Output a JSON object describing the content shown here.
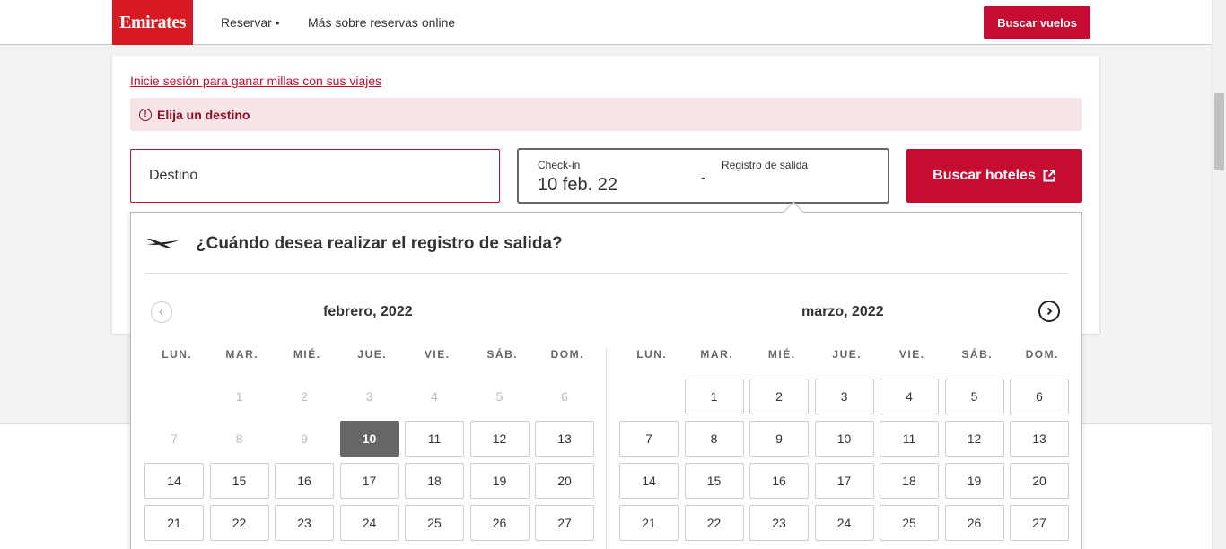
{
  "header": {
    "logo": "Emirates",
    "nav": [
      "Reservar •",
      "Más sobre reservas online"
    ],
    "cta": "Buscar vuelos"
  },
  "booking": {
    "signin_link": "Inicie sesión para ganar millas con sus viajes",
    "alert": "Elija un destino",
    "destination_placeholder": "Destino",
    "checkin_label": "Check-in",
    "checkin_value": "10 feb. 22",
    "dash": "-",
    "checkout_label": "Registro de salida",
    "search_button": "Buscar hoteles"
  },
  "calendar": {
    "question": "¿Cuándo desea realizar el registro de salida?",
    "weekdays": [
      "LUN.",
      "MAR.",
      "MIÉ.",
      "JUE.",
      "VIE.",
      "SÁB.",
      "DOM."
    ],
    "months": [
      {
        "title": "febrero, 2022",
        "days": [
          {
            "d": "",
            "state": "empty"
          },
          {
            "d": "1",
            "state": "disabled"
          },
          {
            "d": "2",
            "state": "disabled"
          },
          {
            "d": "3",
            "state": "disabled"
          },
          {
            "d": "4",
            "state": "disabled"
          },
          {
            "d": "5",
            "state": "disabled"
          },
          {
            "d": "6",
            "state": "disabled"
          },
          {
            "d": "7",
            "state": "disabled"
          },
          {
            "d": "8",
            "state": "disabled"
          },
          {
            "d": "9",
            "state": "disabled"
          },
          {
            "d": "10",
            "state": "selected"
          },
          {
            "d": "11",
            "state": "available"
          },
          {
            "d": "12",
            "state": "available"
          },
          {
            "d": "13",
            "state": "available"
          },
          {
            "d": "14",
            "state": "available"
          },
          {
            "d": "15",
            "state": "available"
          },
          {
            "d": "16",
            "state": "available"
          },
          {
            "d": "17",
            "state": "available"
          },
          {
            "d": "18",
            "state": "available"
          },
          {
            "d": "19",
            "state": "available"
          },
          {
            "d": "20",
            "state": "available"
          },
          {
            "d": "21",
            "state": "available"
          },
          {
            "d": "22",
            "state": "available"
          },
          {
            "d": "23",
            "state": "available"
          },
          {
            "d": "24",
            "state": "available"
          },
          {
            "d": "25",
            "state": "available"
          },
          {
            "d": "26",
            "state": "available"
          },
          {
            "d": "27",
            "state": "available"
          }
        ]
      },
      {
        "title": "marzo, 2022",
        "days": [
          {
            "d": "",
            "state": "empty"
          },
          {
            "d": "1",
            "state": "available"
          },
          {
            "d": "2",
            "state": "available"
          },
          {
            "d": "3",
            "state": "available"
          },
          {
            "d": "4",
            "state": "available"
          },
          {
            "d": "5",
            "state": "available"
          },
          {
            "d": "6",
            "state": "available"
          },
          {
            "d": "7",
            "state": "available"
          },
          {
            "d": "8",
            "state": "available"
          },
          {
            "d": "9",
            "state": "available"
          },
          {
            "d": "10",
            "state": "available"
          },
          {
            "d": "11",
            "state": "available"
          },
          {
            "d": "12",
            "state": "available"
          },
          {
            "d": "13",
            "state": "available"
          },
          {
            "d": "14",
            "state": "available"
          },
          {
            "d": "15",
            "state": "available"
          },
          {
            "d": "16",
            "state": "available"
          },
          {
            "d": "17",
            "state": "available"
          },
          {
            "d": "18",
            "state": "available"
          },
          {
            "d": "19",
            "state": "available"
          },
          {
            "d": "20",
            "state": "available"
          },
          {
            "d": "21",
            "state": "available"
          },
          {
            "d": "22",
            "state": "available"
          },
          {
            "d": "23",
            "state": "available"
          },
          {
            "d": "24",
            "state": "available"
          },
          {
            "d": "25",
            "state": "available"
          },
          {
            "d": "26",
            "state": "available"
          },
          {
            "d": "27",
            "state": "available"
          }
        ]
      }
    ]
  },
  "colors": {
    "brand_red": "#d71921",
    "button_red": "#c60c30",
    "alert_bg": "#f6e4e6",
    "selected_day": "#666666"
  },
  "icons": {
    "alert": "alert-circle-icon",
    "external": "external-link-icon",
    "plane": "plane-icon",
    "prev": "chevron-left-icon",
    "next": "chevron-right-icon"
  }
}
